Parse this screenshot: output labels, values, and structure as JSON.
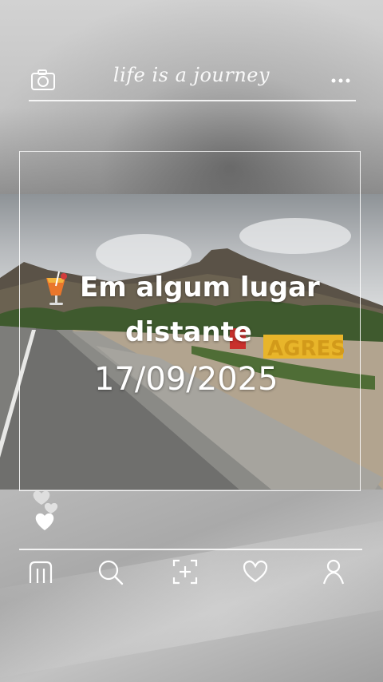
{
  "header": {
    "title": "life is a journey",
    "camera_icon": "camera-icon",
    "more_icon": "more-dots-icon"
  },
  "post": {
    "caption_line1": "Em algum lugar",
    "caption_line2": "distante",
    "date": "17/09/2025",
    "emoji_icon": "tropical-drink-icon",
    "sign_text": "AGRES"
  },
  "reactions": {
    "icon": "hearts-icon"
  },
  "bottom_nav": {
    "items": [
      {
        "name": "home",
        "icon": "home-icon"
      },
      {
        "name": "search",
        "icon": "search-icon"
      },
      {
        "name": "add",
        "icon": "add-square-icon"
      },
      {
        "name": "likes",
        "icon": "heart-icon"
      },
      {
        "name": "profile",
        "icon": "profile-icon"
      }
    ]
  },
  "colors": {
    "frame": "#ffffff",
    "sign_yellow": "#e8b52a",
    "sign_red": "#c9302c",
    "background_gray": "#b8b8b8"
  }
}
